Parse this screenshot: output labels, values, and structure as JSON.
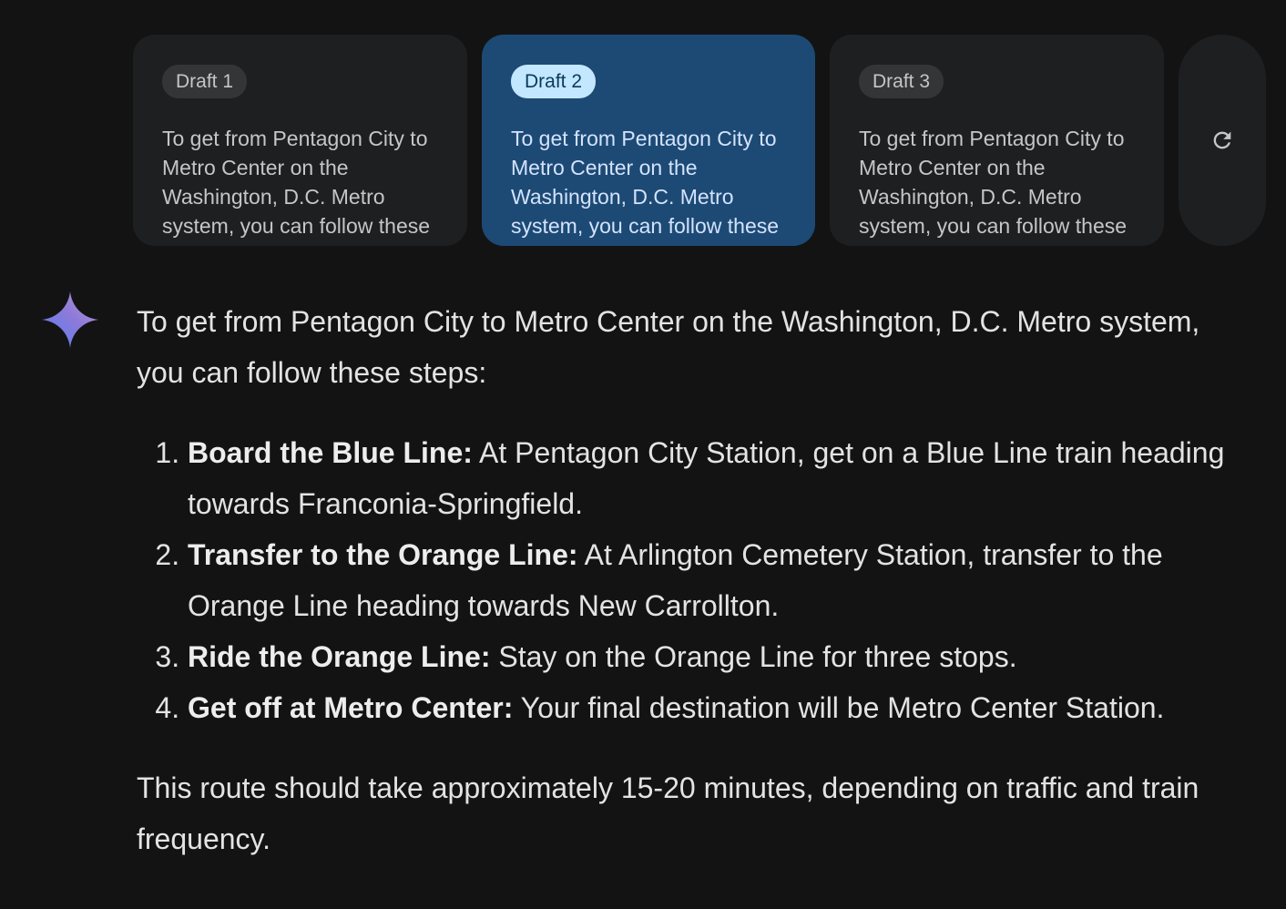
{
  "drafts": [
    {
      "label": "Draft 1",
      "preview": "To get from Pentagon City to Metro Center on the Washington, D.C. Metro system, you can follow these steps:",
      "selected": false
    },
    {
      "label": "Draft 2",
      "preview": "To get from Pentagon City to Metro Center on the Washington, D.C. Metro system, you can follow these steps:",
      "selected": true
    },
    {
      "label": "Draft 3",
      "preview": "To get from Pentagon City to Metro Center on the Washington, D.C. Metro system, you can follow these steps:",
      "selected": false
    }
  ],
  "regenerate_icon": "refresh-icon",
  "response": {
    "intro": "To get from Pentagon City to Metro Center on the Washington, D.C. Metro system, you can follow these steps:",
    "steps": [
      {
        "title": "Board the Blue Line:",
        "text": " At Pentagon City Station, get on a Blue Line train heading towards Franconia-Springfield."
      },
      {
        "title": "Transfer to the Orange Line:",
        "text": " At Arlington Cemetery Station, transfer to the Orange Line heading towards New Carrollton."
      },
      {
        "title": "Ride the Orange Line:",
        "text": " Stay on the Orange Line for three stops."
      },
      {
        "title": "Get off at Metro Center:",
        "text": " Your final destination will be Metro Center Station."
      }
    ],
    "outro": "This route should take approximately 15-20 minutes, depending on traffic and train frequency."
  },
  "colors": {
    "background": "#131314",
    "card": "#1e1f20",
    "selected_card": "#1d4a74",
    "selected_chip": "#c2e7ff"
  }
}
